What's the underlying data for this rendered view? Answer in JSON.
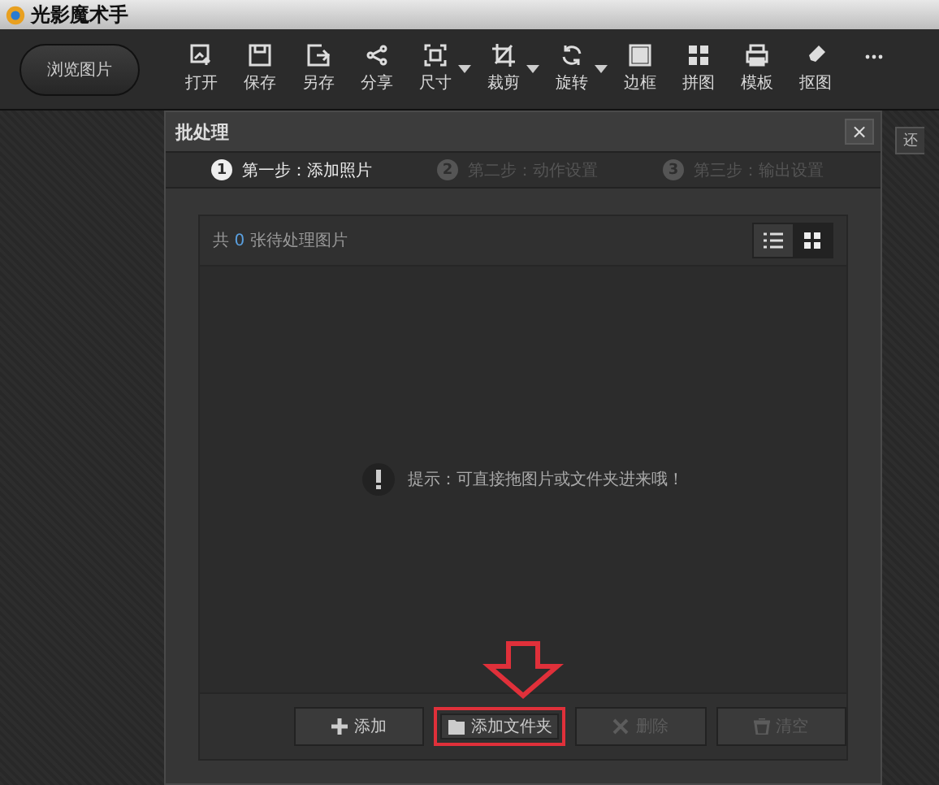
{
  "window": {
    "title": "光影魔术手"
  },
  "browse_button": "浏览图片",
  "toolbar": [
    {
      "label": "打开",
      "kind": "open",
      "dropdown": false
    },
    {
      "label": "保存",
      "kind": "save",
      "dropdown": false
    },
    {
      "label": "另存",
      "kind": "saveas",
      "dropdown": false
    },
    {
      "label": "分享",
      "kind": "share",
      "dropdown": false
    },
    {
      "label": "尺寸",
      "kind": "size",
      "dropdown": true
    },
    {
      "label": "裁剪",
      "kind": "crop",
      "dropdown": true
    },
    {
      "label": "旋转",
      "kind": "rotate",
      "dropdown": true
    },
    {
      "label": "边框",
      "kind": "border",
      "dropdown": false
    },
    {
      "label": "拼图",
      "kind": "grid",
      "dropdown": false
    },
    {
      "label": "模板",
      "kind": "print",
      "dropdown": false
    },
    {
      "label": "抠图",
      "kind": "pen",
      "dropdown": false
    },
    {
      "kind": "more"
    }
  ],
  "side_button": "还",
  "dialog": {
    "title": "批处理",
    "close": "×",
    "steps": [
      {
        "number": "1",
        "label": "第一步：添加照片",
        "selected": true
      },
      {
        "number": "2",
        "label": "第二步：动作设置",
        "selected": false
      },
      {
        "number": "3",
        "label": "第三步：输出设置",
        "selected": false
      }
    ],
    "count_prefix": "共",
    "count": "0",
    "count_suffix": "张待处理图片",
    "view_modes": [
      {
        "kind": "list",
        "selected": false
      },
      {
        "kind": "grid",
        "selected": true
      }
    ],
    "hint": "提示：可直接拖图片或文件夹进来哦！",
    "buttons": [
      {
        "kind": "add",
        "label": "添加",
        "disabled": false,
        "highlighted": false
      },
      {
        "kind": "folder",
        "label": "添加文件夹",
        "disabled": false,
        "highlighted": true
      },
      {
        "kind": "delete",
        "label": "删除",
        "disabled": true,
        "highlighted": false
      },
      {
        "kind": "clear",
        "label": "清空",
        "disabled": true,
        "highlighted": false
      }
    ]
  }
}
